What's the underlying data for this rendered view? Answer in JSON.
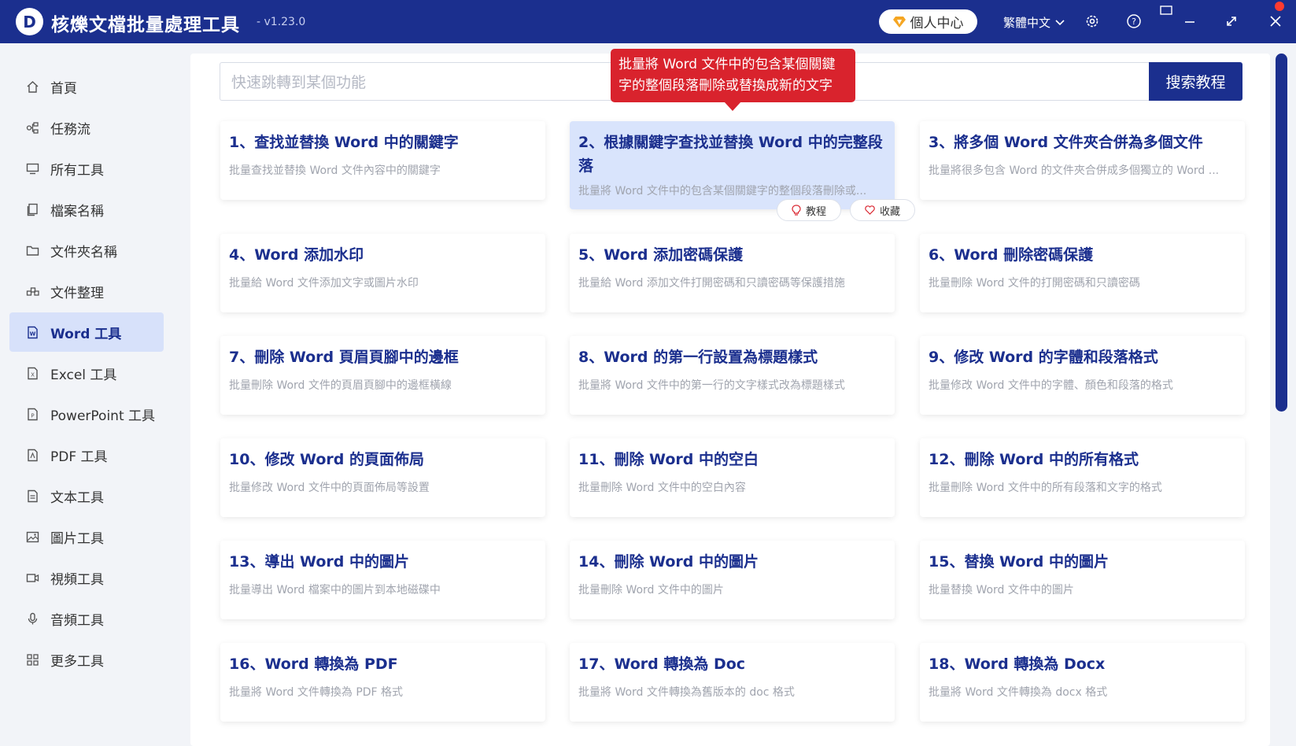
{
  "app": {
    "logo_letter": "D",
    "title": "核爍文檔批量處理工具",
    "version": "- v1.23.0",
    "user_center": "個人中心",
    "language": "繁體中文"
  },
  "colors": {
    "brand": "#1b2f8e",
    "tooltip": "#d9232d",
    "highlight": "#d9e4fc"
  },
  "sidebar": {
    "items": [
      {
        "label": "首頁",
        "icon": "home-icon"
      },
      {
        "label": "任務流",
        "icon": "workflow-icon"
      },
      {
        "label": "所有工具",
        "icon": "monitor-icon"
      },
      {
        "label": "檔案名稱",
        "icon": "file-copy-icon"
      },
      {
        "label": "文件夾名稱",
        "icon": "folder-icon"
      },
      {
        "label": "文件整理",
        "icon": "organize-icon"
      },
      {
        "label": "Word 工具",
        "icon": "word-icon"
      },
      {
        "label": "Excel 工具",
        "icon": "excel-icon"
      },
      {
        "label": "PowerPoint 工具",
        "icon": "ppt-icon"
      },
      {
        "label": "PDF 工具",
        "icon": "pdf-icon"
      },
      {
        "label": "文本工具",
        "icon": "text-icon"
      },
      {
        "label": "圖片工具",
        "icon": "image-icon"
      },
      {
        "label": "視頻工具",
        "icon": "video-icon"
      },
      {
        "label": "音頻工具",
        "icon": "mic-icon"
      },
      {
        "label": "更多工具",
        "icon": "grid-icon"
      }
    ]
  },
  "search": {
    "placeholder": "快速跳轉到某個功能",
    "button": "搜索教程"
  },
  "tooltip": {
    "text": "批量將 Word 文件中的包含某個關鍵字的整個段落刪除或替換成新的文字"
  },
  "card_actions": {
    "tutorial": "教程",
    "favorite": "收藏"
  },
  "cards": [
    {
      "title": "1、查找並替換 Word 中的關鍵字",
      "desc": "批量查找並替換 Word 文件內容中的關鍵字"
    },
    {
      "title": "2、根據關鍵字查找並替換 Word 中的完整段落",
      "desc": "批量將 Word 文件中的包含某個關鍵字的整個段落刪除或..."
    },
    {
      "title": "3、將多個 Word 文件夾合併為多個文件",
      "desc": "批量將很多包含 Word 的文件夾合併成多個獨立的 Word ..."
    },
    {
      "title": "4、Word 添加水印",
      "desc": "批量給 Word 文件添加文字或圖片水印"
    },
    {
      "title": "5、Word 添加密碼保護",
      "desc": "批量給 Word 添加文件打開密碼和只讀密碼等保護措施"
    },
    {
      "title": "6、Word 刪除密碼保護",
      "desc": "批量刪除 Word 文件的打開密碼和只讀密碼"
    },
    {
      "title": "7、刪除 Word 頁眉頁腳中的邊框",
      "desc": "批量刪除 Word 文件的頁眉頁腳中的邊框橫線"
    },
    {
      "title": "8、Word 的第一行設置為標題樣式",
      "desc": "批量將 Word 文件中的第一行的文字樣式改為標題樣式"
    },
    {
      "title": "9、修改 Word 的字體和段落格式",
      "desc": "批量修改 Word 文件中的字體、顏色和段落的格式"
    },
    {
      "title": "10、修改 Word 的頁面佈局",
      "desc": "批量修改 Word 文件中的頁面佈局等設置"
    },
    {
      "title": "11、刪除 Word 中的空白",
      "desc": "批量刪除 Word 文件中的空白內容"
    },
    {
      "title": "12、刪除 Word 中的所有格式",
      "desc": "批量刪除 Word 文件中的所有段落和文字的格式"
    },
    {
      "title": "13、導出 Word 中的圖片",
      "desc": "批量導出 Word 檔案中的圖片到本地磁碟中"
    },
    {
      "title": "14、刪除 Word 中的圖片",
      "desc": "批量刪除 Word 文件中的圖片"
    },
    {
      "title": "15、替換 Word 中的圖片",
      "desc": "批量替換 Word 文件中的圖片"
    },
    {
      "title": "16、Word 轉換為 PDF",
      "desc": "批量將 Word 文件轉換為 PDF 格式"
    },
    {
      "title": "17、Word 轉換為 Doc",
      "desc": "批量將 Word 文件轉換為舊版本的 doc 格式"
    },
    {
      "title": "18、Word 轉換為 Docx",
      "desc": "批量將 Word 文件轉換為 docx 格式"
    }
  ]
}
